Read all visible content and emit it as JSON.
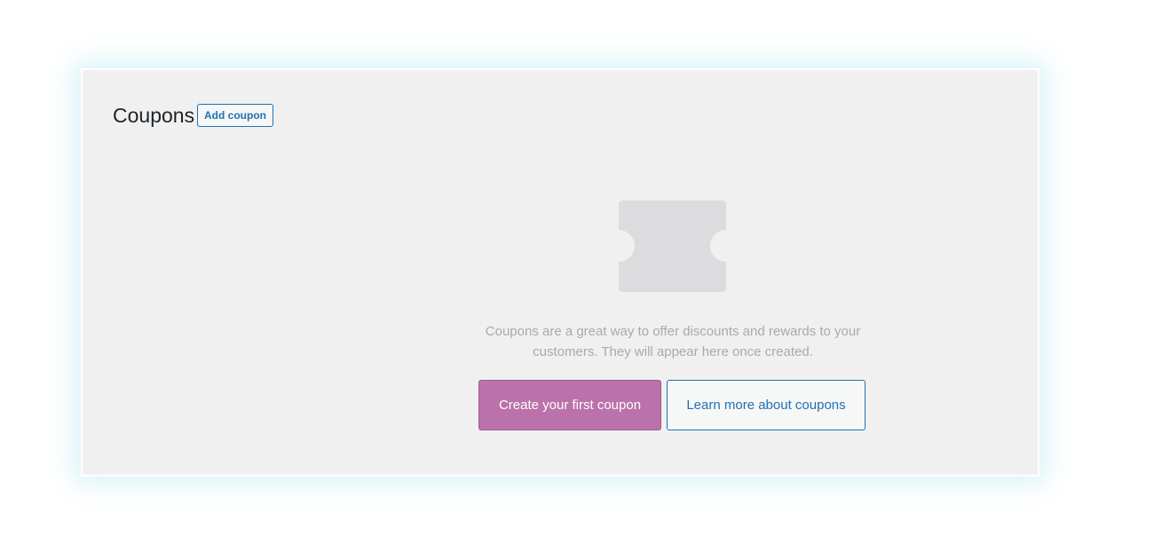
{
  "header": {
    "title": "Coupons",
    "add_button_label": "Add coupon"
  },
  "empty_state": {
    "illustration": "coupon-ticket-icon",
    "message": "Coupons are a great way to offer discounts and rewards to your customers. They will appear here once created.",
    "primary_button_label": "Create your first coupon",
    "secondary_button_label": "Learn more about coupons"
  },
  "colors": {
    "panel_background": "#f0f0f1",
    "primary_button": "#bb72ab",
    "link_blue": "#2271b1",
    "illustration_gray": "#dcdcde",
    "message_text": "#a7aaad"
  }
}
